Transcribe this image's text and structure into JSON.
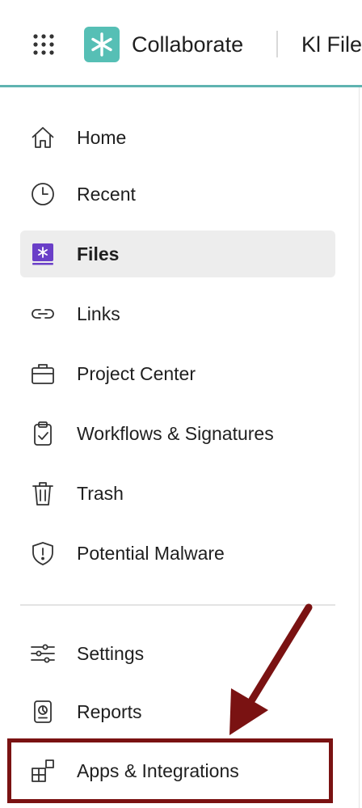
{
  "header": {
    "app_name": "Collaborate",
    "breadcrumb": "Kl Files",
    "apps_grid_icon": "apps-grid-icon",
    "logo_icon": "asterisk-logo-icon",
    "accent_color": "#5fb3b0"
  },
  "sidebar": {
    "items": [
      {
        "label": "Home",
        "icon": "home-icon"
      },
      {
        "label": "Recent",
        "icon": "clock-icon"
      },
      {
        "label": "Files",
        "icon": "files-icon",
        "active": true
      },
      {
        "label": "Links",
        "icon": "link-icon"
      },
      {
        "label": "Project Center",
        "icon": "briefcase-icon"
      },
      {
        "label": "Workflows & Signatures",
        "icon": "clipboard-check-icon"
      },
      {
        "label": "Trash",
        "icon": "trash-icon"
      },
      {
        "label": "Potential Malware",
        "icon": "shield-alert-icon"
      }
    ],
    "secondary_items": [
      {
        "label": "Settings",
        "icon": "sliders-icon"
      },
      {
        "label": "Reports",
        "icon": "report-icon"
      },
      {
        "label": "Apps & Integrations",
        "icon": "apps-integrations-icon"
      }
    ],
    "active_bg": "#ededed",
    "files_icon_color": "#6a3fc8"
  },
  "annotation": {
    "highlight_color": "#7a1212"
  }
}
